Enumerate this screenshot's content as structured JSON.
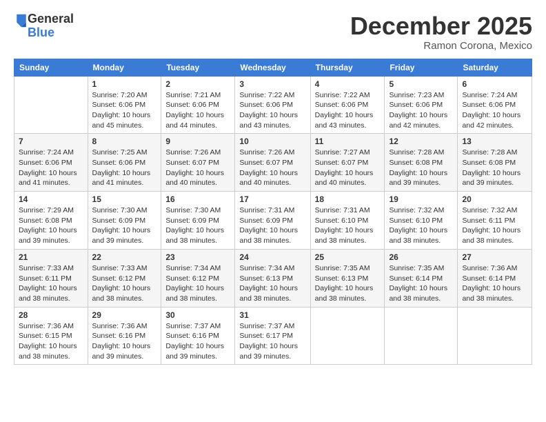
{
  "logo": {
    "general": "General",
    "blue": "Blue"
  },
  "header": {
    "month": "December 2025",
    "location": "Ramon Corona, Mexico"
  },
  "weekdays": [
    "Sunday",
    "Monday",
    "Tuesday",
    "Wednesday",
    "Thursday",
    "Friday",
    "Saturday"
  ],
  "weeks": [
    [
      {
        "day": "",
        "info": ""
      },
      {
        "day": "1",
        "info": "Sunrise: 7:20 AM\nSunset: 6:06 PM\nDaylight: 10 hours\nand 45 minutes."
      },
      {
        "day": "2",
        "info": "Sunrise: 7:21 AM\nSunset: 6:06 PM\nDaylight: 10 hours\nand 44 minutes."
      },
      {
        "day": "3",
        "info": "Sunrise: 7:22 AM\nSunset: 6:06 PM\nDaylight: 10 hours\nand 43 minutes."
      },
      {
        "day": "4",
        "info": "Sunrise: 7:22 AM\nSunset: 6:06 PM\nDaylight: 10 hours\nand 43 minutes."
      },
      {
        "day": "5",
        "info": "Sunrise: 7:23 AM\nSunset: 6:06 PM\nDaylight: 10 hours\nand 42 minutes."
      },
      {
        "day": "6",
        "info": "Sunrise: 7:24 AM\nSunset: 6:06 PM\nDaylight: 10 hours\nand 42 minutes."
      }
    ],
    [
      {
        "day": "7",
        "info": "Sunrise: 7:24 AM\nSunset: 6:06 PM\nDaylight: 10 hours\nand 41 minutes."
      },
      {
        "day": "8",
        "info": "Sunrise: 7:25 AM\nSunset: 6:06 PM\nDaylight: 10 hours\nand 41 minutes."
      },
      {
        "day": "9",
        "info": "Sunrise: 7:26 AM\nSunset: 6:07 PM\nDaylight: 10 hours\nand 40 minutes."
      },
      {
        "day": "10",
        "info": "Sunrise: 7:26 AM\nSunset: 6:07 PM\nDaylight: 10 hours\nand 40 minutes."
      },
      {
        "day": "11",
        "info": "Sunrise: 7:27 AM\nSunset: 6:07 PM\nDaylight: 10 hours\nand 40 minutes."
      },
      {
        "day": "12",
        "info": "Sunrise: 7:28 AM\nSunset: 6:08 PM\nDaylight: 10 hours\nand 39 minutes."
      },
      {
        "day": "13",
        "info": "Sunrise: 7:28 AM\nSunset: 6:08 PM\nDaylight: 10 hours\nand 39 minutes."
      }
    ],
    [
      {
        "day": "14",
        "info": "Sunrise: 7:29 AM\nSunset: 6:08 PM\nDaylight: 10 hours\nand 39 minutes."
      },
      {
        "day": "15",
        "info": "Sunrise: 7:30 AM\nSunset: 6:09 PM\nDaylight: 10 hours\nand 39 minutes."
      },
      {
        "day": "16",
        "info": "Sunrise: 7:30 AM\nSunset: 6:09 PM\nDaylight: 10 hours\nand 38 minutes."
      },
      {
        "day": "17",
        "info": "Sunrise: 7:31 AM\nSunset: 6:09 PM\nDaylight: 10 hours\nand 38 minutes."
      },
      {
        "day": "18",
        "info": "Sunrise: 7:31 AM\nSunset: 6:10 PM\nDaylight: 10 hours\nand 38 minutes."
      },
      {
        "day": "19",
        "info": "Sunrise: 7:32 AM\nSunset: 6:10 PM\nDaylight: 10 hours\nand 38 minutes."
      },
      {
        "day": "20",
        "info": "Sunrise: 7:32 AM\nSunset: 6:11 PM\nDaylight: 10 hours\nand 38 minutes."
      }
    ],
    [
      {
        "day": "21",
        "info": "Sunrise: 7:33 AM\nSunset: 6:11 PM\nDaylight: 10 hours\nand 38 minutes."
      },
      {
        "day": "22",
        "info": "Sunrise: 7:33 AM\nSunset: 6:12 PM\nDaylight: 10 hours\nand 38 minutes."
      },
      {
        "day": "23",
        "info": "Sunrise: 7:34 AM\nSunset: 6:12 PM\nDaylight: 10 hours\nand 38 minutes."
      },
      {
        "day": "24",
        "info": "Sunrise: 7:34 AM\nSunset: 6:13 PM\nDaylight: 10 hours\nand 38 minutes."
      },
      {
        "day": "25",
        "info": "Sunrise: 7:35 AM\nSunset: 6:13 PM\nDaylight: 10 hours\nand 38 minutes."
      },
      {
        "day": "26",
        "info": "Sunrise: 7:35 AM\nSunset: 6:14 PM\nDaylight: 10 hours\nand 38 minutes."
      },
      {
        "day": "27",
        "info": "Sunrise: 7:36 AM\nSunset: 6:14 PM\nDaylight: 10 hours\nand 38 minutes."
      }
    ],
    [
      {
        "day": "28",
        "info": "Sunrise: 7:36 AM\nSunset: 6:15 PM\nDaylight: 10 hours\nand 38 minutes."
      },
      {
        "day": "29",
        "info": "Sunrise: 7:36 AM\nSunset: 6:16 PM\nDaylight: 10 hours\nand 39 minutes."
      },
      {
        "day": "30",
        "info": "Sunrise: 7:37 AM\nSunset: 6:16 PM\nDaylight: 10 hours\nand 39 minutes."
      },
      {
        "day": "31",
        "info": "Sunrise: 7:37 AM\nSunset: 6:17 PM\nDaylight: 10 hours\nand 39 minutes."
      },
      {
        "day": "",
        "info": ""
      },
      {
        "day": "",
        "info": ""
      },
      {
        "day": "",
        "info": ""
      }
    ]
  ]
}
